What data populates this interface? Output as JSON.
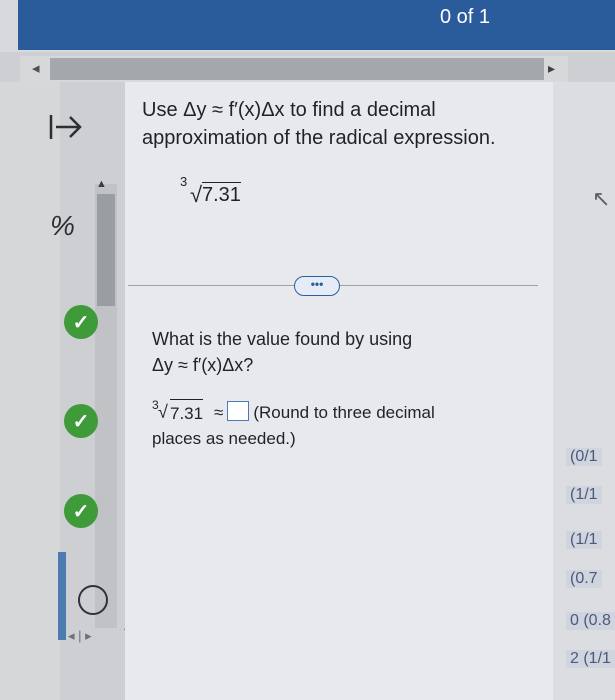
{
  "header": {
    "score": "0 of 1"
  },
  "question": {
    "prompt_line1": "Use Δy ≈ f′(x)Δx to find a decimal",
    "prompt_line2": "approximation of the radical expression.",
    "radical_index": "3",
    "radical_value": "7.31",
    "more_label": "•••",
    "subquestion_line1": "What is the value found by using",
    "subquestion_line2": "Δy ≈ f′(x)Δx?",
    "answer_index": "3",
    "answer_value": "7.31",
    "approx_symbol": "≈",
    "round_note": "(Round to three decimal",
    "round_note2": "places as needed.)"
  },
  "sidebar": {
    "collapse_icon": "arrow-right-bar-icon",
    "percent_icon": "percent-icon",
    "items": [
      {
        "status": "complete"
      },
      {
        "status": "complete"
      },
      {
        "status": "complete"
      },
      {
        "status": "current"
      }
    ],
    "pager": "◂ | ▸"
  },
  "right_panel": {
    "items": [
      "(0/1",
      "(1/1",
      "(1/1",
      "(0.7",
      "0 (0.8",
      "2 (1/1"
    ]
  },
  "colors": {
    "header": "#2a5b9b",
    "check": "#3f9a3a",
    "accent": "#2b5fa5"
  }
}
